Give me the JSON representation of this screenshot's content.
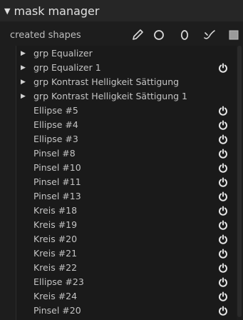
{
  "panel": {
    "title": "mask manager"
  },
  "toolbar": {
    "label": "created shapes",
    "tools": [
      {
        "name": "path-tool",
        "icon": "pencil-icon"
      },
      {
        "name": "circle-tool",
        "icon": "circle-icon"
      },
      {
        "name": "ellipse-tool",
        "icon": "ellipse-icon"
      },
      {
        "name": "brush-tool",
        "icon": "brush-icon"
      },
      {
        "name": "gradient-tool",
        "icon": "square-icon"
      }
    ]
  },
  "shapes": [
    {
      "label": "grp Equalizer",
      "group": true,
      "power": false
    },
    {
      "label": "grp Equalizer 1",
      "group": true,
      "power": true
    },
    {
      "label": "grp Kontrast Helligkeit Sättigung",
      "group": true,
      "power": false
    },
    {
      "label": "grp Kontrast Helligkeit Sättigung 1",
      "group": true,
      "power": false
    },
    {
      "label": "Ellipse #5",
      "group": false,
      "power": true
    },
    {
      "label": "Ellipse #4",
      "group": false,
      "power": true
    },
    {
      "label": "Ellipse #3",
      "group": false,
      "power": true
    },
    {
      "label": "Pinsel #8",
      "group": false,
      "power": true
    },
    {
      "label": "Pinsel #10",
      "group": false,
      "power": true
    },
    {
      "label": "Pinsel #11",
      "group": false,
      "power": true
    },
    {
      "label": "Pinsel #13",
      "group": false,
      "power": true
    },
    {
      "label": "Kreis #18",
      "group": false,
      "power": true
    },
    {
      "label": "Kreis #19",
      "group": false,
      "power": true
    },
    {
      "label": "Kreis #20",
      "group": false,
      "power": true
    },
    {
      "label": "Kreis #21",
      "group": false,
      "power": true
    },
    {
      "label": "Kreis #22",
      "group": false,
      "power": true
    },
    {
      "label": "Ellipse #23",
      "group": false,
      "power": true
    },
    {
      "label": "Kreis #24",
      "group": false,
      "power": true
    },
    {
      "label": "Pinsel #20",
      "group": false,
      "power": true
    }
  ],
  "colors": {
    "background": "#1d1d1d",
    "text": "#c4c4c4",
    "header": "#262626"
  }
}
